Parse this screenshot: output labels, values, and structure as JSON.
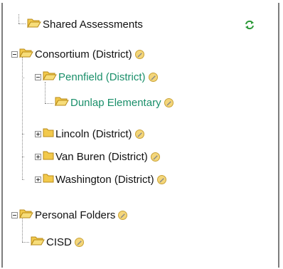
{
  "tree": {
    "shared": "Shared Assessments",
    "consortium": "Consortium (District)",
    "pennfield": "Pennfield (District)",
    "dunlap": "Dunlap Elementary",
    "lincoln": "Lincoln (District)",
    "van_buren": "Van Buren (District)",
    "washington": "Washington (District)",
    "personal": "Personal Folders",
    "cisd": "CISD"
  },
  "colors": {
    "active_node": "#1a8f6a",
    "folder": "#f2c94c",
    "refresh": "#2e9a3a"
  },
  "icons": {
    "refresh": "refresh-icon",
    "open_folder": "folder-open-icon",
    "closed_folder": "folder-closed-icon",
    "edit": "pencil-icon"
  }
}
